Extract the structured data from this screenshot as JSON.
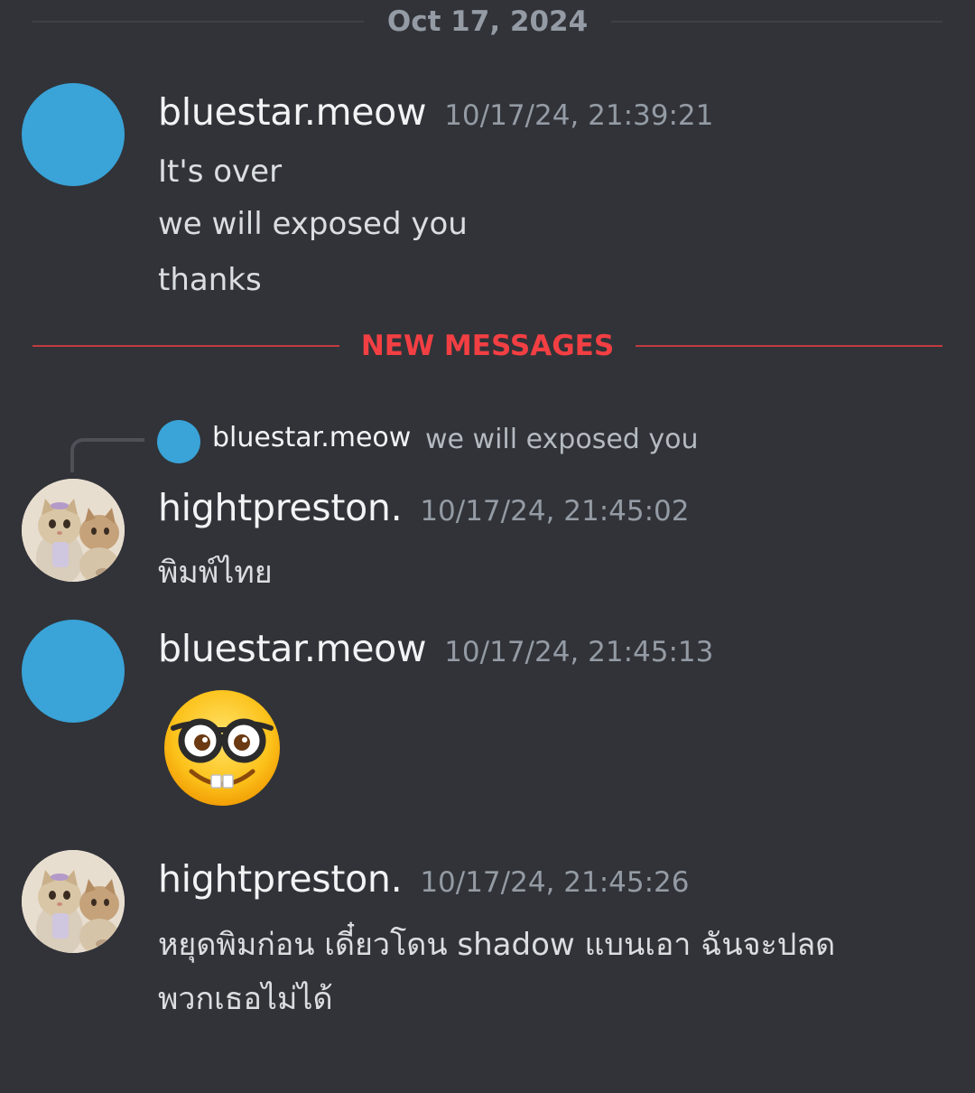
{
  "date_divider": "Oct 17, 2024",
  "new_messages_divider": "NEW MESSAGES",
  "messages": [
    {
      "username": "bluestar.meow",
      "timestamp": "10/17/24, 21:39:21",
      "avatar": "blue-circle",
      "lines": [
        "It's over",
        "we will exposed you",
        "thanks"
      ]
    },
    {
      "username": "hightpreston.",
      "timestamp": "10/17/24, 21:45:02",
      "avatar": "cats-photo",
      "reply": {
        "username": "bluestar.meow",
        "text": "we will exposed you"
      },
      "lines": [
        "พิมพ์ไทย"
      ]
    },
    {
      "username": "bluestar.meow",
      "timestamp": "10/17/24, 21:45:13",
      "avatar": "blue-circle",
      "emoji": "nerd-face-emoji"
    },
    {
      "username": "hightpreston.",
      "timestamp": "10/17/24, 21:45:26",
      "avatar": "cats-photo",
      "lines": [
        "หยุดพิมก่อน เดี๋ยวโดน shadow แบนเอา ฉันจะปลด",
        "พวกเธอไม่ได้"
      ]
    }
  ],
  "colors": {
    "background": "#313338",
    "new_messages_red": "#f23f43",
    "bluestar_avatar": "#3aa3d8"
  }
}
